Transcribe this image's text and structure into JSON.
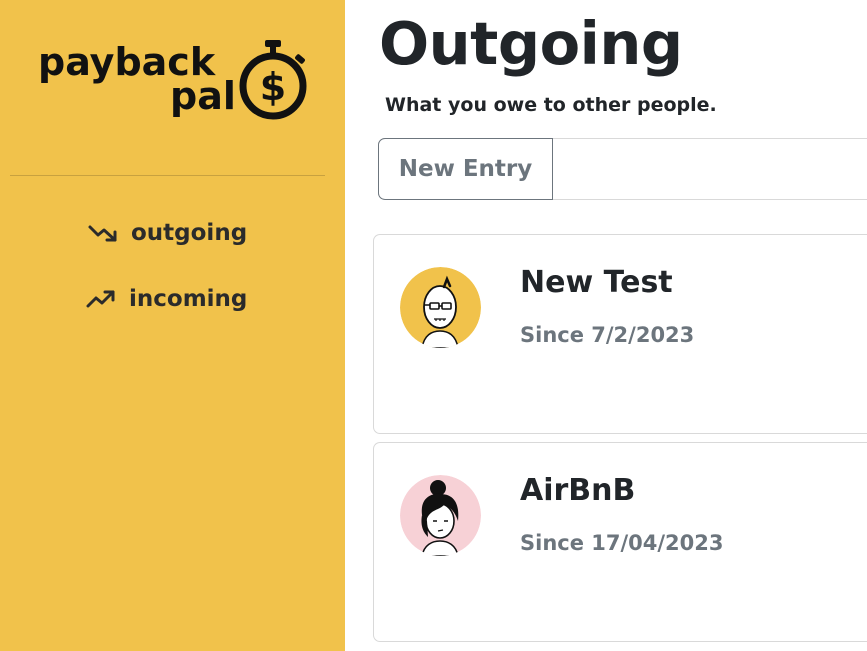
{
  "app": {
    "logo_text_line1": "payback",
    "logo_text_line2": "pal",
    "logo_icon": "stopwatch-dollar-icon"
  },
  "sidebar": {
    "items": [
      {
        "label": "outgoing",
        "icon": "trending-down-icon"
      },
      {
        "label": "incoming",
        "icon": "trending-up-icon"
      }
    ]
  },
  "main": {
    "title": "Outgoing",
    "subtitle": "What you owe to other people.",
    "new_entry_label": "New Entry",
    "entries": [
      {
        "name": "New Test",
        "since": "Since 7/2/2023",
        "avatar": "bald-man-glasses-avatar",
        "avatar_bg": "#f1c24b"
      },
      {
        "name": "AirBnB",
        "since": "Since 17/04/2023",
        "avatar": "woman-hair-bun-avatar",
        "avatar_bg": "#f7d1d6"
      }
    ]
  },
  "colors": {
    "sidebar_bg": "#f1c24b",
    "muted_text": "#6c757d",
    "border": "#d9d9d9"
  }
}
